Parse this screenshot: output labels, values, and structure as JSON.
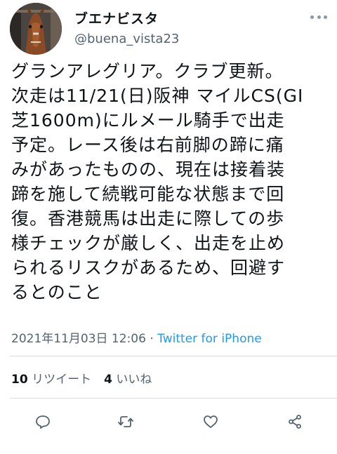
{
  "user": {
    "display_name": "ブエナビスタ",
    "handle": "@buena_vista23"
  },
  "tweet": {
    "text": "グランアレグリア。クラブ更新。\n次走は11/21(日)阪神 マイルCS(GI\n芝1600m)にルメール騎手で出走\n予定。レース後は右前脚の蹄に痛\nみがあったものの、現在は接着装\n蹄を施して続戦可能な状態まで回\n復。香港競馬は出走に際しての歩\n様チェックが厳しく、出走を止め\nられるリスクがあるため、回避す\nるとのこと",
    "timestamp": "2021年11月03日 12:06",
    "separator": " · ",
    "source": "Twitter for iPhone"
  },
  "stats": {
    "retweets_count": "10",
    "retweets_label": "リツイート",
    "likes_count": "4",
    "likes_label": "いいね"
  },
  "icons": {
    "more": "more-horizontal-icon",
    "reply": "reply-icon",
    "retweet": "retweet-icon",
    "like": "heart-icon",
    "share": "share-icon"
  },
  "colors": {
    "link": "#1d9bf0",
    "secondary_text": "#536471",
    "divider": "#d9dde1"
  }
}
